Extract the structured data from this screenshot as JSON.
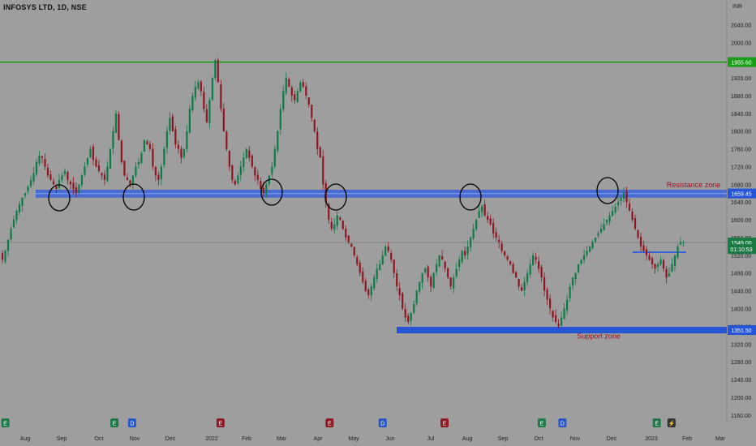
{
  "header": {
    "title": "INFOSYS LTD, 1D, NSE"
  },
  "colors": {
    "background": "#9e9e9e",
    "up_candle": "#0e7a47",
    "down_candle": "#8f1620",
    "resistance_line": "#1a9e1a",
    "zone_band": "#3a62d8",
    "support_bar": "#2554d6",
    "annotation_text": "#9a1222",
    "price_label_bg": "#1b7a44",
    "circle": "#000000"
  },
  "chart_data": {
    "type": "candlestick",
    "currency_label": "INR",
    "y_ticks": [
      1160,
      1200,
      1240,
      1280,
      1320,
      1360,
      1400,
      1440,
      1480,
      1520,
      1560,
      1600,
      1640,
      1680,
      1720,
      1760,
      1800,
      1840,
      1880,
      1920,
      1960,
      2000,
      2040
    ],
    "y_tick_labels": [
      "1160.00",
      "1200.00",
      "1240.00",
      "1280.00",
      "1320.00",
      "1360.00",
      "1400.00",
      "1440.00",
      "1480.00",
      "1520.00",
      "1560.00",
      "1600.00",
      "1640.00",
      "1680.00",
      "1720.00",
      "1760.00",
      "1800.00",
      "1840.00",
      "1880.00",
      "1920.00",
      "1960.00",
      "2000.00",
      "2040.00"
    ],
    "ylim": [
      1145,
      2070
    ],
    "x_range_days": [
      0,
      232
    ],
    "x_ticks": [
      {
        "label": "Aug",
        "day": 7
      },
      {
        "label": "Sep",
        "day": 26
      },
      {
        "label": "Oct",
        "day": 45
      },
      {
        "label": "Nov",
        "day": 65
      },
      {
        "label": "Dec",
        "day": 85
      },
      {
        "label": "2022",
        "day": 107
      },
      {
        "label": "Feb",
        "day": 127
      },
      {
        "label": "Mar",
        "day": 146
      },
      {
        "label": "Apr",
        "day": 165
      },
      {
        "label": "May",
        "day": 184
      },
      {
        "label": "Jun",
        "day": 204
      },
      {
        "label": "Jul",
        "day": 224
      }
    ],
    "x_tick_labels_extra": [
      "Aug",
      "Sep",
      "Oct",
      "Nov",
      "Dec",
      "2023",
      "Feb",
      "Mar"
    ],
    "price_labels": [
      {
        "text": "1955.60",
        "value": 1955.6,
        "kind": "green"
      },
      {
        "text": "1659.45",
        "value": 1659.45,
        "kind": "blue"
      },
      {
        "text": "1549.00",
        "value": 1549,
        "kind": "last"
      },
      {
        "text": "01:10:53",
        "value": 1534,
        "kind": "last"
      },
      {
        "text": "1351.50",
        "value": 1351.5,
        "kind": "blue"
      }
    ],
    "annotations": [
      {
        "text": "Resistance zone",
        "value": 1679
      },
      {
        "text": "Support zone",
        "value": 1338
      }
    ],
    "lines": {
      "resistance_top": 1955.6,
      "zone_top": 1668,
      "zone_bottom": 1650,
      "support": 1351.5,
      "last_price": 1549,
      "small_level": 1527
    },
    "closes": [
      1510,
      1530,
      1555,
      1580,
      1600,
      1620,
      1635,
      1650,
      1660,
      1675,
      1690,
      1705,
      1730,
      1745,
      1740,
      1720,
      1700,
      1690,
      1680,
      1670,
      1690,
      1700,
      1710,
      1690,
      1680,
      1670,
      1660,
      1680,
      1700,
      1720,
      1740,
      1760,
      1735,
      1720,
      1710,
      1700,
      1690,
      1720,
      1760,
      1800,
      1840,
      1780,
      1730,
      1700,
      1690,
      1680,
      1700,
      1720,
      1730,
      1750,
      1780,
      1770,
      1760,
      1720,
      1700,
      1690,
      1720,
      1760,
      1800,
      1830,
      1800,
      1770,
      1760,
      1740,
      1760,
      1800,
      1850,
      1880,
      1900,
      1910,
      1890,
      1850,
      1820,
      1870,
      1920,
      1960,
      1910,
      1850,
      1800,
      1760,
      1720,
      1690,
      1680,
      1700,
      1720,
      1740,
      1760,
      1740,
      1720,
      1700,
      1690,
      1670,
      1660,
      1680,
      1700,
      1720,
      1760,
      1800,
      1850,
      1890,
      1920,
      1900,
      1880,
      1870,
      1890,
      1910,
      1900,
      1880,
      1860,
      1830,
      1800,
      1760,
      1740,
      1680,
      1640,
      1600,
      1580,
      1590,
      1610,
      1600,
      1580,
      1560,
      1550,
      1540,
      1520,
      1500,
      1480,
      1460,
      1440,
      1430,
      1450,
      1470,
      1490,
      1500,
      1520,
      1540,
      1530,
      1510,
      1480,
      1450,
      1430,
      1400,
      1380,
      1370,
      1390,
      1410,
      1440,
      1460,
      1480,
      1490,
      1470,
      1450,
      1480,
      1500,
      1520,
      1510,
      1490,
      1470,
      1450,
      1470,
      1490,
      1510,
      1530,
      1520,
      1540,
      1560,
      1580,
      1600,
      1620,
      1630,
      1610,
      1600,
      1590,
      1570,
      1560,
      1550,
      1530,
      1520,
      1510,
      1500,
      1480,
      1470,
      1450,
      1440,
      1460,
      1480,
      1500,
      1520,
      1510,
      1490,
      1470,
      1440,
      1420,
      1400,
      1380,
      1370,
      1360,
      1380,
      1400,
      1420,
      1450,
      1470,
      1480,
      1500,
      1510,
      1520,
      1530,
      1540,
      1550,
      1560,
      1570,
      1580,
      1590,
      1600,
      1610,
      1620,
      1630,
      1640,
      1650,
      1660,
      1640,
      1620,
      1600,
      1580,
      1560,
      1540,
      1530,
      1520,
      1510,
      1500,
      1490,
      1500,
      1510,
      1490,
      1470,
      1480,
      1500,
      1520,
      1540,
      1550,
      1549
    ]
  },
  "markers": [
    {
      "letter": "E",
      "color": "#1f7a48",
      "day": 1
    },
    {
      "letter": "E",
      "color": "#1f7a48",
      "day": 38
    },
    {
      "letter": "D",
      "color": "#2a55c8",
      "day": 44
    },
    {
      "letter": "E",
      "color": "#8e1b24",
      "day": 74
    },
    {
      "letter": "E",
      "color": "#8e1b24",
      "day": 111
    },
    {
      "letter": "D",
      "color": "#2a55c8",
      "day": 129
    },
    {
      "letter": "E",
      "color": "#8e1b24",
      "day": 150
    },
    {
      "letter": "E",
      "color": "#1f7a48",
      "day": 183
    },
    {
      "letter": "D",
      "color": "#2a55c8",
      "day": 190
    },
    {
      "letter": "E",
      "color": "#1f7a48",
      "day": 222
    },
    {
      "letter": "⚡",
      "color": "#333333",
      "day": 227
    }
  ]
}
